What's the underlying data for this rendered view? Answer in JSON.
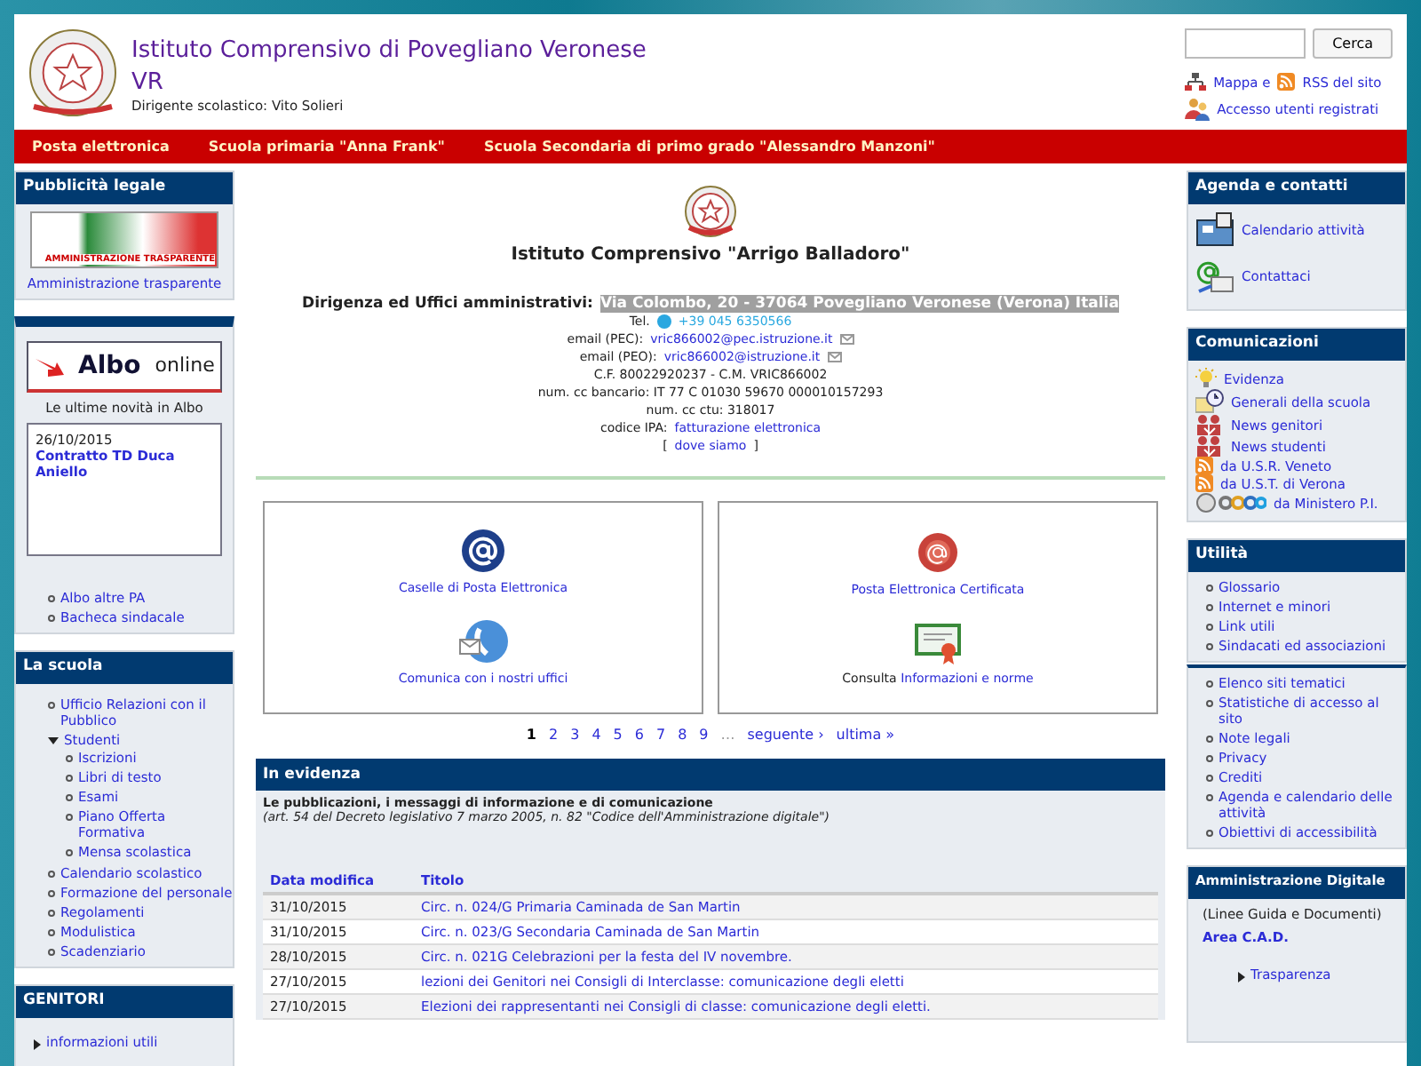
{
  "header": {
    "title_lines": [
      "Istituto Comprensivo di Povegliano Veronese",
      "VR"
    ],
    "subtitle": "Dirigente scolastico: Vito Solieri",
    "search": {
      "button": "Cerca"
    },
    "links": [
      {
        "kind": "sitemap",
        "text": "Mappa e"
      },
      {
        "kind": "rss",
        "text": "RSS del sito"
      },
      {
        "kind": "login",
        "text": "Accesso utenti registrati"
      }
    ]
  },
  "nav": [
    "Posta elettronica",
    "Scuola primaria \"Anna Frank\"",
    "Scuola Secondaria di primo grado \"Alessandro Manzoni\""
  ],
  "left": {
    "pubblicita": {
      "title": "Pubblicità legale",
      "banner": "AMMINISTRAZIONE TRASPARENTE",
      "link": "Amministrazione trasparente"
    },
    "albo": {
      "banner_bold": "Albo",
      "banner_light": "online",
      "caption": "Le ultime novità in Albo",
      "news": {
        "date": "26/10/2015",
        "title": "Contratto TD Duca Aniello"
      },
      "links": [
        "Albo altre PA",
        "Bacheca sindacale"
      ]
    },
    "la_scuola": {
      "title": "La scuola",
      "items": [
        {
          "label": "Ufficio Relazioni con il Pubblico"
        },
        {
          "label": "Studenti",
          "expanded": true,
          "children": [
            {
              "label": "Iscrizioni"
            },
            {
              "label": "Libri di testo"
            },
            {
              "label": "Esami"
            },
            {
              "label": "Piano Offerta Formativa"
            },
            {
              "label": "Mensa scolastica"
            }
          ]
        },
        {
          "label": "Calendario scolastico"
        },
        {
          "label": "Formazione del personale"
        },
        {
          "label": "Regolamenti"
        },
        {
          "label": "Modulistica"
        },
        {
          "label": "Scadenziario"
        }
      ]
    },
    "genitori": {
      "title": "GENITORI",
      "items": [
        {
          "label": "informazioni utili",
          "expanded": false
        }
      ]
    }
  },
  "center": {
    "school_name": "Istituto Comprensivo \"Arrigo Balladoro\"",
    "address_label": "Dirigenza ed Uffici amministrativi:",
    "address": "Via Colombo, 20 - 37064 Povegliano Veronese (Verona) Italia",
    "contacts": [
      {
        "kind": "phone",
        "label": "Tel.",
        "value": "+39 045 6350566"
      },
      {
        "kind": "email",
        "label": "email (PEC):",
        "value": "vric866002@pec.istruzione.it"
      },
      {
        "kind": "email",
        "label": "email (PEO):",
        "value": "vric866002@istruzione.it"
      },
      {
        "kind": "text",
        "label": "C.F. 80022920237 - C.M. VRIC866002"
      },
      {
        "kind": "text",
        "label": "num. cc bancario: IT 77 C 01030 59670 000010157293"
      },
      {
        "kind": "text",
        "label": "num. cc ctu: 318017"
      },
      {
        "kind": "link",
        "label": "codice IPA:",
        "value": "fatturazione elettronica"
      },
      {
        "kind": "bracket",
        "label": "[",
        "value": "dove siamo",
        "end": "]"
      }
    ],
    "panels": [
      {
        "items": [
          {
            "kind": "at",
            "text": "Caselle di Posta Elettronica"
          },
          {
            "kind": "phone-mail",
            "text": "Comunica con i nostri uffici"
          }
        ]
      },
      {
        "items": [
          {
            "kind": "seal",
            "text": "Posta Elettronica Certificata"
          },
          {
            "kind": "certificate",
            "prefix": "Consulta",
            "text": "Informazioni e norme"
          }
        ]
      }
    ],
    "pager": [
      {
        "kind": "page",
        "text": "1",
        "selected": true
      },
      {
        "kind": "page",
        "text": "2",
        "selected": false
      },
      {
        "kind": "page",
        "text": "3",
        "selected": false
      },
      {
        "kind": "page",
        "text": "4",
        "selected": false
      },
      {
        "kind": "page",
        "text": "5",
        "selected": false
      },
      {
        "kind": "page",
        "text": "6",
        "selected": false
      },
      {
        "kind": "page",
        "text": "7",
        "selected": false
      },
      {
        "kind": "page",
        "text": "8",
        "selected": false
      },
      {
        "kind": "page",
        "text": "9",
        "selected": false
      },
      {
        "kind": "gap",
        "text": "…"
      },
      {
        "kind": "page",
        "text": "seguente ›",
        "selected": false
      },
      {
        "kind": "page",
        "text": "ultima »",
        "selected": false
      }
    ],
    "evidenza": {
      "title": "In evidenza",
      "intro": "Le pubblicazioni, i messaggi di informazione e di comunicazione",
      "note": "(art. 54 del Decreto legislativo 7 marzo 2005, n. 82 \"Codice dell'Amministrazione digitale\")",
      "columns": [
        "Data modifica",
        "Titolo"
      ],
      "rows": [
        [
          "31/10/2015",
          "Circ. n. 024/G Primaria Caminada de San Martin"
        ],
        [
          "31/10/2015",
          "Circ. n. 023/G Secondaria Caminada de San Martin"
        ],
        [
          "28/10/2015",
          "Circ. n. 021G Celebrazioni per la festa del IV novembre."
        ],
        [
          "27/10/2015",
          "lezioni dei Genitori nei Consigli di Interclasse: comunicazione degli eletti"
        ],
        [
          "27/10/2015",
          "Elezioni dei rappresentanti nei Consigli di classe: comunicazione degli eletti."
        ]
      ]
    }
  },
  "right": {
    "agenda": {
      "title": "Agenda e contatti",
      "items": [
        {
          "kind": "calendar",
          "text": "Calendario attività"
        },
        {
          "kind": "contact",
          "text": "Contattaci"
        }
      ]
    },
    "comunicazioni": {
      "title": "Comunicazioni",
      "items": [
        {
          "kind": "bulb",
          "text": "Evidenza"
        },
        {
          "kind": "clock",
          "text": "Generali della scuola"
        },
        {
          "kind": "people",
          "text": "News genitori"
        },
        {
          "kind": "people",
          "text": "News studenti"
        },
        {
          "kind": "rss",
          "text": "da U.S.R. Veneto"
        },
        {
          "kind": "rss",
          "text": "da U.S.T. di Verona"
        },
        {
          "kind": "ministry",
          "text": "da Ministero P.I."
        }
      ]
    },
    "utilita": {
      "title": "Utilità",
      "items": [
        "Glossario",
        "Internet e minori",
        "Link utili",
        "Sindacati ed associazioni"
      ]
    },
    "altri": {
      "items": [
        "Elenco siti tematici",
        "Statistiche di accesso al sito",
        "Note legali",
        "Privacy",
        "Crediti",
        "Agenda e calendario delle attività",
        "Obiettivi di accessibilità"
      ]
    },
    "digitale": {
      "title": "Amministrazione Digitale",
      "subtitle": "(Linee Guida e Documenti)",
      "area": "Area C.A.D.",
      "items": [
        {
          "label": "Trasparenza",
          "expanded": false
        }
      ]
    }
  }
}
